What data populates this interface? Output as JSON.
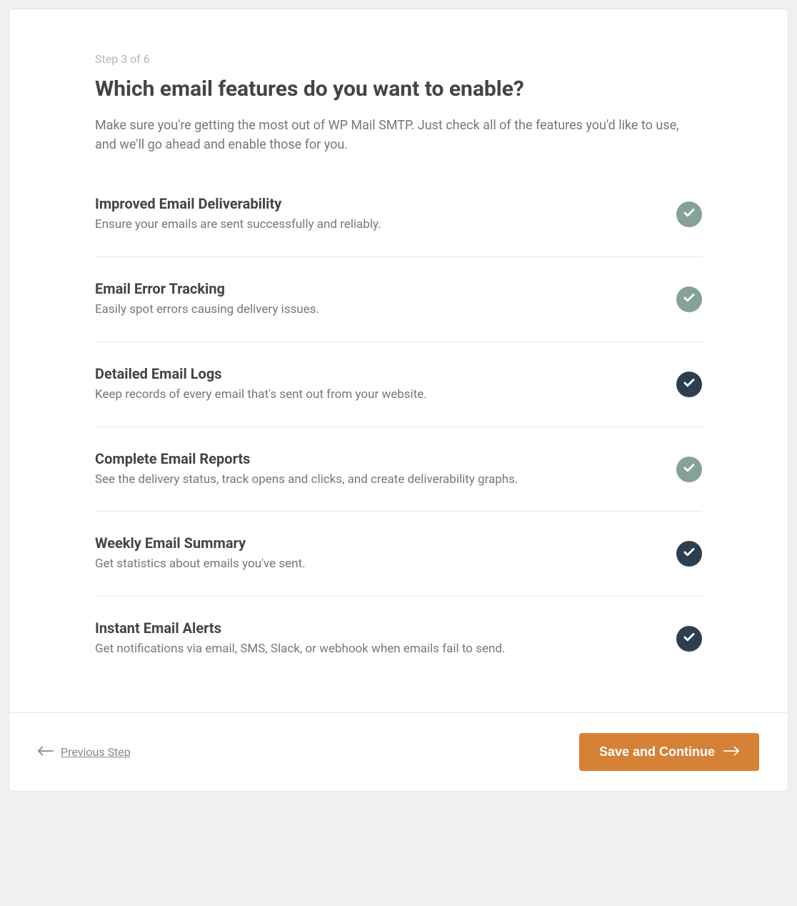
{
  "step_label": "Step 3 of 6",
  "heading": "Which email features do you want to enable?",
  "subheading": "Make sure you're getting the most out of WP Mail SMTP. Just check all of the features you'd like to use, and we'll go ahead and enable those for you.",
  "features": [
    {
      "title": "Improved Email Deliverability",
      "desc": "Ensure your emails are sent successfully and reliably.",
      "state": "locked-on"
    },
    {
      "title": "Email Error Tracking",
      "desc": "Easily spot errors causing delivery issues.",
      "state": "locked-on"
    },
    {
      "title": "Detailed Email Logs",
      "desc": "Keep records of every email that's sent out from your website.",
      "state": "on"
    },
    {
      "title": "Complete Email Reports",
      "desc": "See the delivery status, track opens and clicks, and create deliverability graphs.",
      "state": "locked-on"
    },
    {
      "title": "Weekly Email Summary",
      "desc": "Get statistics about emails you've sent.",
      "state": "on"
    },
    {
      "title": "Instant Email Alerts",
      "desc": "Get notifications via email, SMS, Slack, or webhook when emails fail to send.",
      "state": "on"
    }
  ],
  "footer": {
    "prev_label": "Previous Step",
    "save_label": "Save and Continue"
  },
  "colors": {
    "locked_toggle": "#86a196",
    "active_toggle": "#2c3e50",
    "primary_button": "#d58136"
  }
}
